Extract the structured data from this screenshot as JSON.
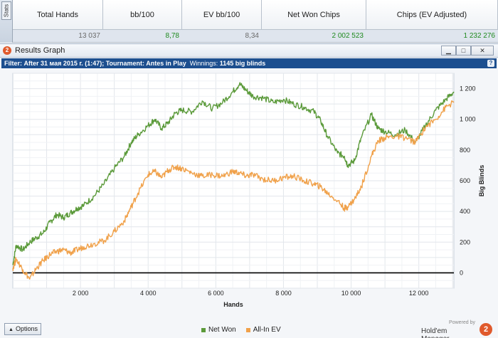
{
  "side_tab": {
    "label": "Stats"
  },
  "stats": {
    "headers": [
      "Total Hands",
      "bb/100",
      "EV bb/100",
      "Net Won Chips",
      "Chips (EV Adjusted)"
    ],
    "values": [
      "13 037",
      "8,78",
      "8,34",
      "2 002 523",
      "1 232 276"
    ]
  },
  "window": {
    "title": "Results Graph",
    "min_icon": "minimize-icon",
    "max_icon": "maximize-icon",
    "close_icon": "close-icon"
  },
  "filter": {
    "prefix": "Filter:",
    "text": "After 31 мая 2015 г. (1:47); Tournament: Antes in Play",
    "winnings_label": "Winnings:",
    "winnings_value": "1145 big blinds",
    "help_icon": "help-icon"
  },
  "footer": {
    "options_label": "Options",
    "powered_by": "Powered by",
    "brand_name": "Hold'em Manager"
  },
  "colors": {
    "net_won": "#5b9a3a",
    "allin_ev": "#f0a14a",
    "zero_line": "#000000",
    "filter_bar": "#1d4f8f"
  },
  "chart_data": {
    "type": "line",
    "xlabel": "Hands",
    "ylabel": "Big Blinds",
    "xlim": [
      0,
      13037
    ],
    "ylim": [
      -100,
      1300
    ],
    "x_ticks": [
      2000,
      4000,
      6000,
      8000,
      10000,
      12000
    ],
    "x_tick_labels": [
      "2 000",
      "4 000",
      "6 000",
      "8 000",
      "10 000",
      "12 000"
    ],
    "y_ticks": [
      0,
      200,
      400,
      600,
      800,
      1000,
      1200
    ],
    "y_tick_labels": [
      "0",
      "200",
      "400",
      "600",
      "800",
      "1 000",
      "1 200"
    ],
    "grid": true,
    "legend": "bottom-center",
    "series": [
      {
        "name": "Net Won",
        "x": [
          0,
          100,
          300,
          500,
          700,
          900,
          1100,
          1300,
          1500,
          1700,
          1900,
          2100,
          2400,
          2700,
          3000,
          3300,
          3500,
          3700,
          4000,
          4200,
          4400,
          4600,
          4800,
          5000,
          5300,
          5600,
          5900,
          6200,
          6500,
          6700,
          6900,
          7100,
          7400,
          7700,
          8000,
          8300,
          8600,
          8900,
          9100,
          9300,
          9600,
          9800,
          9900,
          10100,
          10300,
          10600,
          10800,
          11000,
          11300,
          11600,
          11900,
          12200,
          12500,
          12800,
          13037
        ],
        "y": [
          50,
          180,
          150,
          200,
          230,
          260,
          330,
          380,
          360,
          390,
          420,
          440,
          500,
          580,
          680,
          760,
          850,
          900,
          960,
          1000,
          940,
          980,
          1040,
          1060,
          1050,
          1120,
          1070,
          1110,
          1180,
          1230,
          1190,
          1150,
          1140,
          1110,
          1130,
          1100,
          1080,
          1050,
          990,
          890,
          780,
          760,
          700,
          730,
          880,
          1030,
          940,
          920,
          900,
          930,
          850,
          960,
          1060,
          1130,
          1180
        ]
      },
      {
        "name": "All-In EV",
        "x": [
          0,
          100,
          300,
          500,
          700,
          900,
          1100,
          1300,
          1500,
          1700,
          1900,
          2100,
          2400,
          2700,
          3000,
          3300,
          3500,
          3700,
          4000,
          4200,
          4400,
          4600,
          4800,
          5000,
          5300,
          5600,
          5900,
          6200,
          6500,
          6700,
          6900,
          7100,
          7400,
          7700,
          8000,
          8300,
          8600,
          8900,
          9100,
          9300,
          9600,
          9800,
          9900,
          10100,
          10300,
          10600,
          10800,
          11000,
          11300,
          11600,
          11900,
          12200,
          12500,
          12800,
          13037
        ],
        "y": [
          30,
          90,
          20,
          -40,
          30,
          80,
          120,
          140,
          150,
          130,
          150,
          170,
          190,
          210,
          270,
          340,
          430,
          520,
          640,
          660,
          620,
          670,
          690,
          680,
          650,
          630,
          640,
          630,
          660,
          650,
          630,
          640,
          610,
          600,
          620,
          630,
          600,
          580,
          560,
          520,
          470,
          420,
          430,
          480,
          560,
          760,
          860,
          880,
          890,
          880,
          850,
          950,
          1000,
          1080,
          1110
        ]
      }
    ]
  }
}
